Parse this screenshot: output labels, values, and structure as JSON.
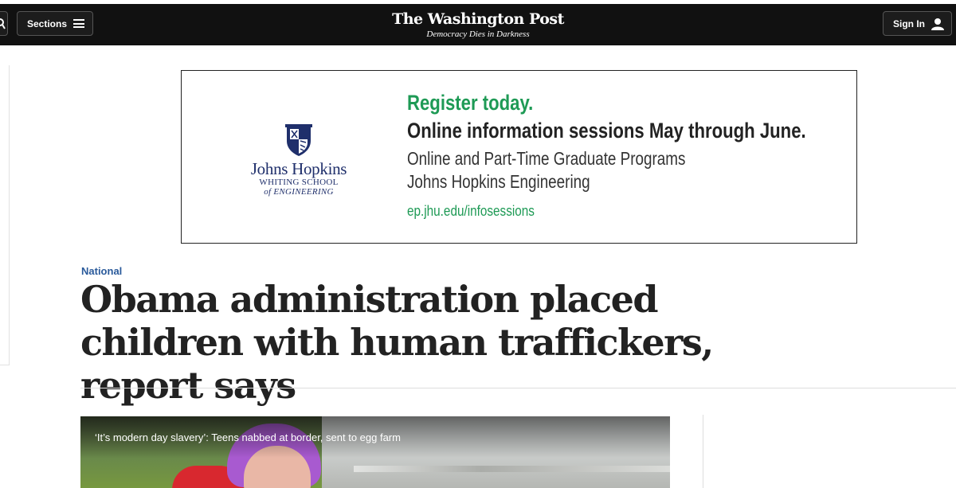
{
  "header": {
    "sections_label": "Sections",
    "logo_text": "The Washington Post",
    "tagline": "Democracy Dies in Darkness",
    "signin_label": "Sign In"
  },
  "ad": {
    "brand_name": "Johns Hopkins",
    "brand_sub1": "WHITING SCHOOL",
    "brand_sub2": "of ENGINEERING",
    "headline": "Register today.",
    "subheadline": "Online information sessions May through June.",
    "line1": "Online and Part-Time Graduate Programs",
    "line2": "Johns Hopkins Engineering",
    "url": "ep.jhu.edu/infosessions",
    "accent_color": "#1e9a55",
    "brand_color": "#1f2f6b"
  },
  "article": {
    "kicker": "National",
    "headline": "Obama administration placed children with human traffickers, report says",
    "kicker_color": "#2a5a9b"
  },
  "video": {
    "caption": "‘It’s modern day slavery’: Teens nabbed at border, sent to egg farm"
  },
  "icons": [
    "search-icon",
    "hamburger-icon",
    "user-icon",
    "jhu-shield-icon"
  ]
}
